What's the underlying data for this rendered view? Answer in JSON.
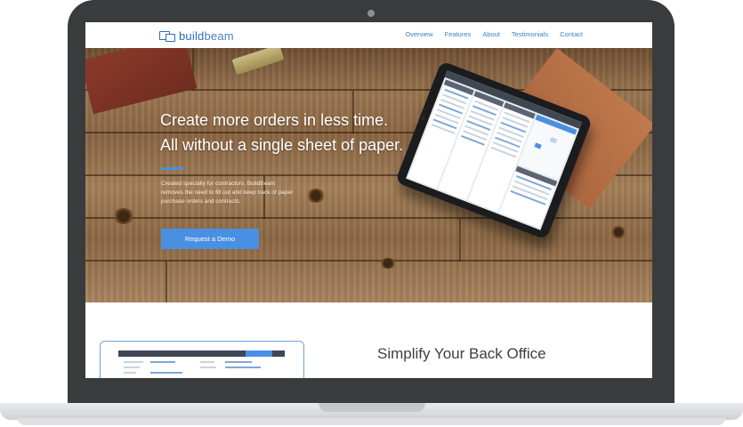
{
  "brand": {
    "word1": "build",
    "word2": "beam"
  },
  "nav": {
    "links": [
      "Overview",
      "Features",
      "About",
      "Testimonials",
      "Contact"
    ]
  },
  "hero": {
    "title_line1": "Create more orders in less time.",
    "title_line2": "All without a single sheet of paper.",
    "description": "Created specially for contractors, BuildBeam removes the need to fill out and keep track of paper purchase orders and contracts.",
    "cta_label": "Request a Demo"
  },
  "section": {
    "title": "Simplify Your Back Office"
  },
  "colors": {
    "accent": "#4a90e2",
    "nav_link": "#3b7fc8",
    "laptop_frame": "#3a3b3d"
  }
}
